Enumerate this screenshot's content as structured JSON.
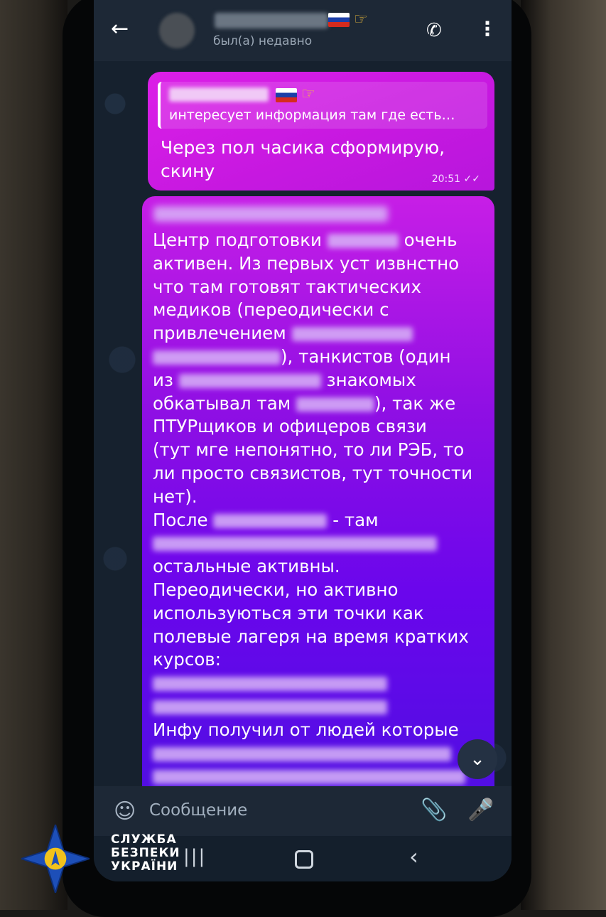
{
  "header": {
    "back_icon": "arrow-left-icon",
    "status": "был(а) недавно",
    "call_icon": "phone-icon",
    "menu_icon": "more-vert-icon"
  },
  "message1": {
    "reply_preview": "интересует информация там где есть…",
    "text": "Через пол часика сформирую, скину",
    "time": "20:51",
    "read_icon": "double-check-icon"
  },
  "message2": {
    "lines": [
      "Центр подготовки",
      "очень",
      "активен. Из первых уст извнстно",
      "что там готовят тактических",
      "медиков (переодически с",
      "привлечением",
      "), танкистов (один",
      "из",
      "знакомых",
      "обкатывал там",
      "), так же",
      "ПТУРщиков и офицеров связи",
      "(тут мге непонятно, то ли РЭБ, то",
      "ли просто связистов, тут точности",
      "нет).",
      "После",
      "- там",
      "остальные активны.",
      "Переодически, но активно",
      "используються эти точки как",
      "полевые лагеря на время кратких",
      "курсов:",
      "Инфу получил от людей которые"
    ]
  },
  "scroll_down_icon": "chevron-down-icon",
  "composer": {
    "emoji_icon": "sticker-icon",
    "placeholder": "Сообщение",
    "attach_icon": "paperclip-icon",
    "mic_icon": "microphone-icon"
  },
  "navbar": {
    "recent_icon": "recent-apps-icon",
    "home_icon": "home-icon",
    "back_icon": "nav-back-icon"
  },
  "watermark": {
    "line1": "СЛУЖБА",
    "line2": "БЕЗПЕКИ",
    "line3": "УКРАЇНИ"
  },
  "colors": {
    "bubble_top": "#dc1fe7",
    "bubble_bottom": "#4f0fe2",
    "header_bg": "#1d2836",
    "logo_blue": "#1d4fb8",
    "logo_gold": "#f2c21b"
  }
}
